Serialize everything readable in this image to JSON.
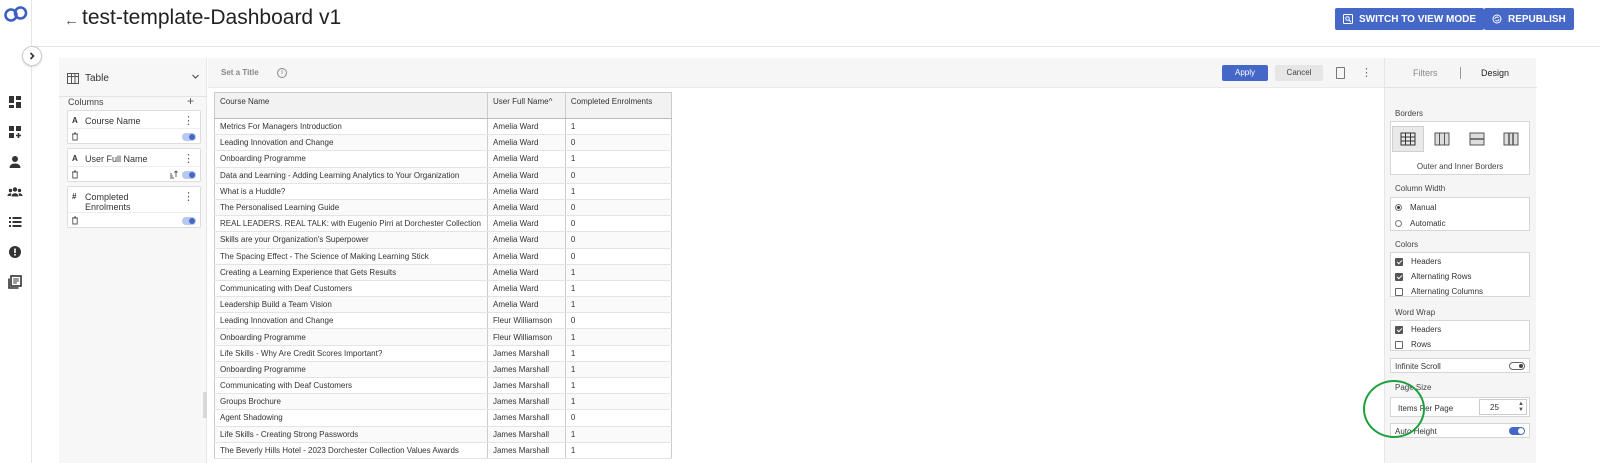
{
  "header": {
    "title": "test-template-Dashboard v1",
    "switch_view_label": "SWITCH TO VIEW MODE",
    "republish_label": "REPUBLISH"
  },
  "config_panel": {
    "visualization_type": "Table",
    "columns_label": "Columns",
    "columns": [
      {
        "type_glyph": "A",
        "name": "Course Name"
      },
      {
        "type_glyph": "A",
        "name": "User Full Name"
      },
      {
        "type_glyph": "#",
        "name": "Completed Enrolments"
      }
    ]
  },
  "canvas": {
    "title_placeholder": "Set a Title",
    "info_glyph": "i",
    "apply_label": "Apply",
    "cancel_label": "Cancel"
  },
  "table": {
    "headers": [
      "Course Name",
      "User Full Name",
      "Completed Enrolments"
    ],
    "sort_indicator": "^",
    "rows": [
      [
        "Metrics For Managers Introduction",
        "Amelia Ward",
        "1"
      ],
      [
        "Leading Innovation and Change",
        "Amelia Ward",
        "0"
      ],
      [
        "Onboarding Programme",
        "Amelia Ward",
        "1"
      ],
      [
        "Data and Learning - Adding Learning Analytics to Your Organization",
        "Amelia Ward",
        "0"
      ],
      [
        "What is a Huddle?",
        "Amelia Ward",
        "1"
      ],
      [
        "The Personalised Learning Guide",
        "Amelia Ward",
        "0"
      ],
      [
        "REAL LEADERS. REAL TALK: with Eugenio Pirri at Dorchester Collection",
        "Amelia Ward",
        "0"
      ],
      [
        "Skills are your Organization's Superpower",
        "Amelia Ward",
        "0"
      ],
      [
        "The Spacing Effect - The Science of Making Learning Stick",
        "Amelia Ward",
        "0"
      ],
      [
        "Creating a Learning Experience that Gets Results",
        "Amelia Ward",
        "1"
      ],
      [
        "Communicating with Deaf Customers",
        "Amelia Ward",
        "1"
      ],
      [
        "Leadership Build a Team Vision",
        "Amelia Ward",
        "1"
      ],
      [
        "Leading Innovation and Change",
        "Fleur Williamson",
        "0"
      ],
      [
        "Onboarding Programme",
        "Fleur Williamson",
        "1"
      ],
      [
        "Life Skills - Why Are Credit Scores Important?",
        "James Marshall",
        "1"
      ],
      [
        "Onboarding Programme",
        "James Marshall",
        "1"
      ],
      [
        "Communicating with Deaf Customers",
        "James Marshall",
        "1"
      ],
      [
        "Groups Brochure",
        "James Marshall",
        "1"
      ],
      [
        "Agent Shadowing",
        "James Marshall",
        "0"
      ],
      [
        "Life Skills - Creating Strong Passwords",
        "James Marshall",
        "1"
      ],
      [
        "The Beverly Hills Hotel - 2023 Dorchester Collection Values Awards",
        "James Marshall",
        "1"
      ]
    ]
  },
  "right_panel": {
    "tabs": [
      "Filters",
      "Design"
    ],
    "active_tab": "Design",
    "borders_label": "Borders",
    "border_selected_label": "Outer and Inner Borders",
    "column_width_label": "Column Width",
    "column_width_options": [
      "Manual",
      "Automatic"
    ],
    "colors_label": "Colors",
    "colors_options": [
      "Headers",
      "Alternating Rows",
      "Alternating Columns"
    ],
    "word_wrap_label": "Word Wrap",
    "word_wrap_options": [
      "Headers",
      "Rows"
    ],
    "infinite_scroll_label": "Infinite Scroll",
    "page_size_label": "Page Size",
    "items_per_page_label": "Items Per Page",
    "items_per_page_value": "25",
    "auto_height_label": "Auto Height"
  },
  "icons": {
    "nav": [
      "dashboard-icon",
      "add-dashboard-icon",
      "user-icon",
      "users-group-icon",
      "list-icon",
      "alert-icon",
      "library-icon"
    ]
  },
  "colors": {
    "accent": "#4568c8",
    "annotation_circle": "#1aa13c"
  }
}
